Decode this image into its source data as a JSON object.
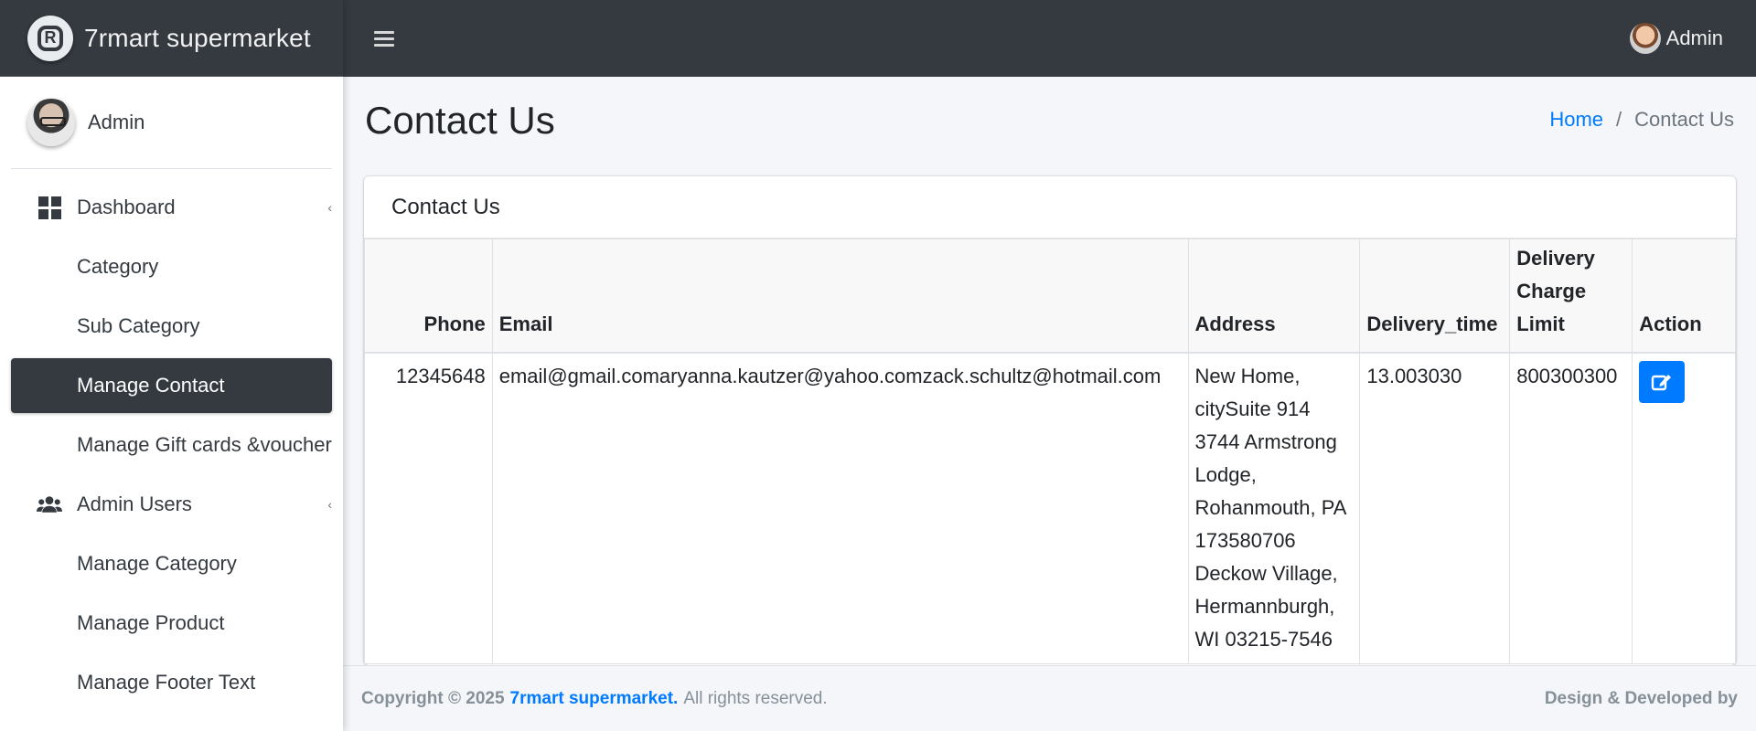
{
  "brand": {
    "name": "7rmart supermarket",
    "logo_letter": "R"
  },
  "user_panel": {
    "name": "Admin"
  },
  "sidebar": {
    "items": [
      {
        "label": "Dashboard"
      },
      {
        "label": "Category"
      },
      {
        "label": "Sub Category"
      },
      {
        "label": "Manage Contact"
      },
      {
        "label": "Manage Gift cards &voucher"
      },
      {
        "label": "Admin Users"
      },
      {
        "label": "Manage Category"
      },
      {
        "label": "Manage Product"
      },
      {
        "label": "Manage Footer Text"
      }
    ],
    "active": "Manage Contact"
  },
  "topbar": {
    "user_name": "Admin"
  },
  "page": {
    "title": "Contact Us",
    "breadcrumb_home": "Home",
    "breadcrumb_separator": "/",
    "breadcrumb_current": "Contact Us"
  },
  "card": {
    "title": "Contact Us",
    "columns": [
      "Phone",
      "Email",
      "Address",
      "Delivery_time",
      "Delivery Charge Limit",
      "Action"
    ],
    "rows": [
      {
        "phone": "12345648",
        "email": "email@gmail.comaryanna.kautzer@yahoo.comzack.schultz@hotmail.com",
        "address": "New Home, citySuite 914 3744 Armstrong Lodge, Rohanmouth, PA 173580706 Deckow Village, Hermannburgh, WI 03215-7546",
        "delivery_time": "13.003030",
        "delivery_charge_limit": "800300300"
      }
    ]
  },
  "footer": {
    "copyright": "Copyright © 2025",
    "brand": "7rmart supermarket.",
    "rights": "All rights reserved.",
    "right_text": "Design & Developed by"
  },
  "colors": {
    "topbar": "#343a40",
    "sidebar_active": "#343a40",
    "accent": "#007bff",
    "content_bg": "#f4f6f9"
  },
  "icons": {
    "menu": "hamburger-icon",
    "dashboard": "dashboard-icon",
    "admin_users": "users-icon",
    "edit": "edit-icon"
  }
}
